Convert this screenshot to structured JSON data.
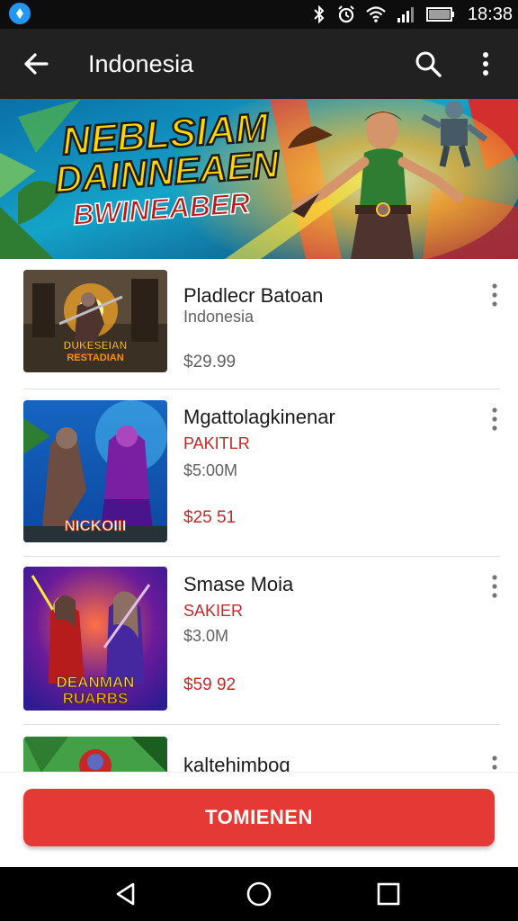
{
  "status_bar": {
    "time": "18:38"
  },
  "app_bar": {
    "title": "Indonesia"
  },
  "banner": {
    "line1": "NEBLSIAM",
    "line2": "DAINNEAEN",
    "line3": "BWINEABER"
  },
  "items": [
    {
      "name": "Pladlecr Batoan",
      "sub": "Indonesia",
      "sub_color": "gray",
      "price": "$29.99",
      "price_color": "gray",
      "thumb_caption": "DUKESEIAN\nRESTADIAN"
    },
    {
      "name": "Mgattolagkinenar",
      "sub": "PAKITLR",
      "sub_color": "red",
      "extra": "$5:00M",
      "price": "$25 51",
      "price_color": "red",
      "thumb_caption": "NICKOIII"
    },
    {
      "name": "Smase Moia",
      "sub": "SAKIER",
      "sub_color": "red",
      "extra": "$3.0M",
      "price": "$59 92",
      "price_color": "red",
      "thumb_caption": "DEANMAN\nRUARBS"
    },
    {
      "name": "kaltehimbog",
      "thumb_caption": ""
    }
  ],
  "cta": {
    "label": "TOMIENEN"
  },
  "colors": {
    "accent": "#e53935",
    "appbar": "#212121",
    "statusbar": "#0d0d0d",
    "price_red": "#c62828"
  }
}
